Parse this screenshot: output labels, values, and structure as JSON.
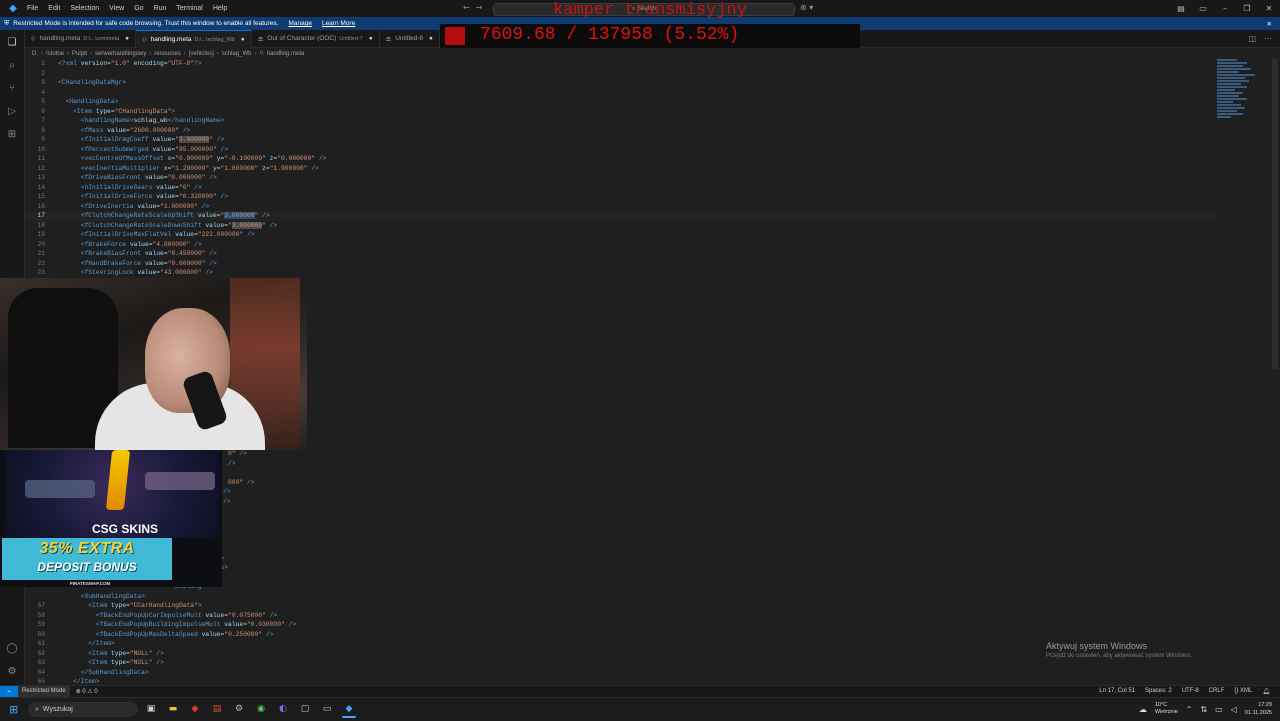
{
  "app": {
    "menu": [
      "File",
      "Edit",
      "Selection",
      "View",
      "Go",
      "Run",
      "Terminal",
      "Help"
    ],
    "search_label": "Search"
  },
  "banner": {
    "text": "Restricted Mode is intended for safe code browsing. Trust this window to enable all features.",
    "manage": "Manage",
    "learn_more": "Learn More"
  },
  "tabs": [
    {
      "label": "handling.meta",
      "path": "D:\\...\\cemmeta",
      "active": false,
      "modified": true
    },
    {
      "label": "handling.meta",
      "path": "D:\\...\\schlag_Wb",
      "active": true,
      "modified": true
    },
    {
      "label": "Out of Character (OOC)",
      "path": "Untitled-7",
      "active": false,
      "modified": true
    },
    {
      "label": "Untitled-6",
      "path": "",
      "active": false,
      "modified": true
    }
  ],
  "breadcrumb": [
    "D:",
    "!stotne",
    "Pulpit",
    "serwerhandlingowy",
    "resources",
    "[vehicles]",
    "schlag_Wb",
    "handling.meta"
  ],
  "stream_overlay": {
    "title": "kamper transmisyjny",
    "value": "7609.68 / 137958 (5.52%)"
  },
  "ad": {
    "brand": "CSG SKINS",
    "promo_line1": "35% EXTRA",
    "promo_line2": "DEPOSIT BONUS",
    "site": "PIRATESWAP.COM"
  },
  "windows_activation": {
    "title": "Aktywuj system Windows",
    "subtitle": "Przejdź do ustawień, aby aktywować system Windows."
  },
  "statusbar": {
    "mode": "Restricted Mode",
    "problems": "⊗ 0 ⚠ 0",
    "position": "Ln 17, Col 51",
    "spaces": "Spaces: 2",
    "encoding": "UTF-8",
    "eol": "CRLF",
    "language": "{} XML"
  },
  "taskbar": {
    "search_placeholder": "Wyszukaj",
    "weather_temp": "10°C",
    "weather_desc": "Wietrznie",
    "time": "17:29",
    "date": "01.11.2025"
  },
  "colors": {
    "accent": "#0078d4",
    "banner": "#0e3b72",
    "overlay_red": "#e01010",
    "ad_cyan": "#3fb9d6",
    "ad_gold": "#f5d03a"
  }
}
